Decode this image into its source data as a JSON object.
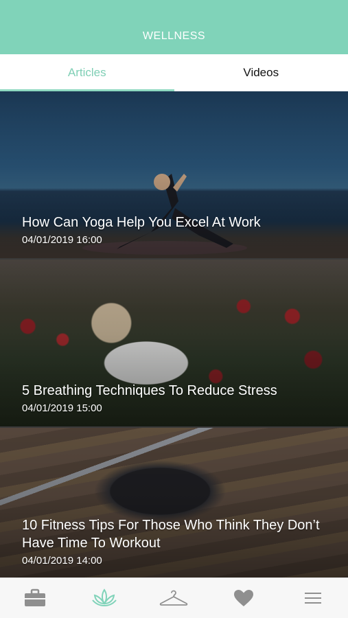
{
  "header": {
    "title": "WELLNESS"
  },
  "tabs": [
    {
      "label": "Articles",
      "active": true
    },
    {
      "label": "Videos",
      "active": false
    }
  ],
  "articles": [
    {
      "title": "How Can Yoga Help You Excel At Work",
      "date": "04/01/2019 16:00"
    },
    {
      "title": "5 Breathing Techniques To Reduce Stress",
      "date": "04/01/2019 15:00"
    },
    {
      "title": "10 Fitness Tips For Those Who Think They Don’t Have Time To Workout",
      "date": "04/01/2019 14:00"
    }
  ],
  "bottom_nav": [
    {
      "icon": "briefcase-icon",
      "active": false
    },
    {
      "icon": "lotus-icon",
      "active": true
    },
    {
      "icon": "hanger-icon",
      "active": false
    },
    {
      "icon": "heart-icon",
      "active": false
    },
    {
      "icon": "menu-icon",
      "active": false
    }
  ],
  "colors": {
    "accent": "#80d3b9",
    "active_tab_text": "#7fcfb5",
    "inactive_icon": "#8f8f8f"
  }
}
